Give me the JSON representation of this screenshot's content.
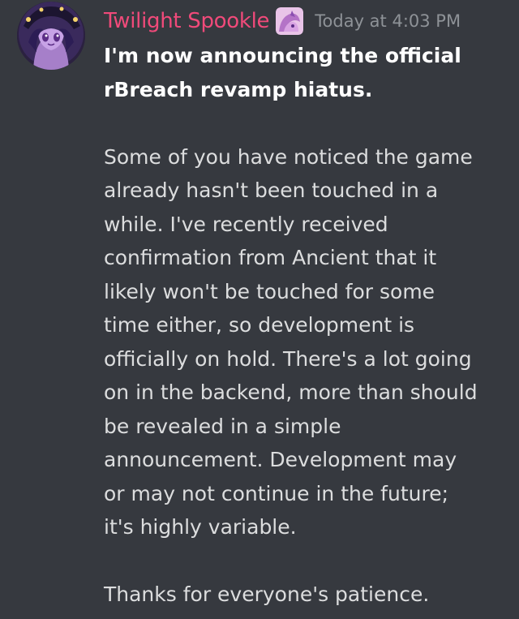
{
  "message": {
    "author": "Twilight Spookle",
    "timestamp": "Today at 4:03 PM",
    "avatar_icon": "pony-avatar-icon",
    "role_icon": "pony-badge-icon",
    "colors": {
      "background": "#36393f",
      "username": "#f04a7a",
      "timestamp": "#8e9297",
      "text": "#dcddde",
      "bold_text": "#ffffff"
    },
    "body": {
      "announcement_line1": "I'm now announcing the official",
      "announcement_line2": "rBreach revamp hiatus.",
      "para1": [
        "Some of you have noticed the game",
        "already hasn't been touched in a",
        "while. I've recently received",
        "confirmation from Ancient that it",
        "likely won't be touched for some",
        "time either, so development is",
        "officially on hold. There's a lot going",
        "on in the backend, more than should",
        "be revealed in a simple",
        "announcement. Development may",
        "or may not continue in the future;",
        "it's highly variable."
      ],
      "closing": "Thanks for everyone's patience."
    }
  }
}
